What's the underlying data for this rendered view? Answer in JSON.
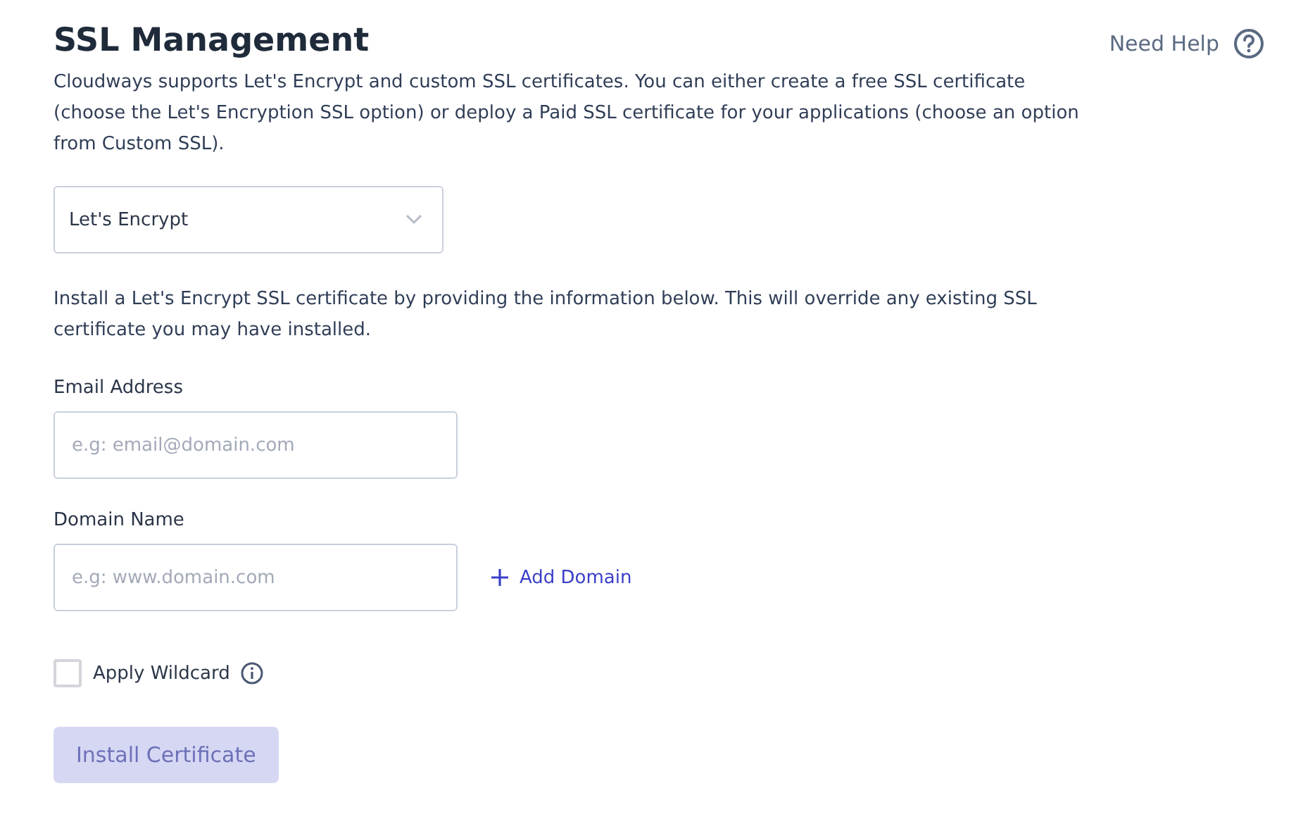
{
  "title": "SSL Management",
  "help": {
    "label": "Need Help"
  },
  "intro": "Cloudways supports Let's Encrypt and custom SSL certificates. You can either create a free SSL certificate (choose the Let's Encryption SSL option) or deploy a Paid SSL certificate for your applications (choose an option from Custom SSL).",
  "ssl_type": {
    "value": "Let's Encrypt"
  },
  "note": "Install a Let's Encrypt SSL certificate by providing the information below. This will override any existing SSL certificate you may have installed.",
  "fields": [
    {
      "label": "Email Address",
      "placeholder": "e.g: email@domain.com"
    },
    {
      "label": "Domain Name",
      "placeholder": "e.g: www.domain.com",
      "add_link": "Add Domain"
    }
  ],
  "wildcard": {
    "label": "Apply Wildcard",
    "checked": false
  },
  "install_button": {
    "label": "Install Certificate",
    "disabled": true
  }
}
